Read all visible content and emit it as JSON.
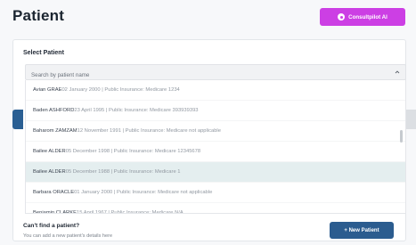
{
  "header": {
    "title": "Patient",
    "ai_button_label": "Consultpilot AI"
  },
  "select_patient": {
    "label": "Select Patient",
    "search_placeholder": "Search by patient name",
    "options": [
      {
        "name": "Avian GRAE",
        "details": "02 January 2000 | Public Insurance: Medicare 1234",
        "highlighted": false
      },
      {
        "name": "Baden ASHFORD",
        "details": "23 April 1995 | Public Insurance: Medicare 393939393",
        "highlighted": false
      },
      {
        "name": "Baharom ZAMZAM",
        "details": "12 November 1991 | Public Insurance: Medicare not applicable",
        "highlighted": false
      },
      {
        "name": "Bailee ALDER",
        "details": "05 December 1998 | Public Insurance: Medicare 12345678",
        "highlighted": false
      },
      {
        "name": "Bailee ALDER",
        "details": "05 December 1988 | Public Insurance: Medicare 1",
        "highlighted": true
      },
      {
        "name": "Barbara ORACLE",
        "details": "01 January 2000 | Public Insurance: Medicare not applicable",
        "highlighted": false
      },
      {
        "name": "Benjamin CLARKE",
        "details": "15 April 1967 | Public Insurance: Medicare N/A",
        "highlighted": false
      }
    ]
  },
  "footer": {
    "cant_find_title": "Can't find a patient?",
    "cant_find_subtitle": "You can add a new patient's details here",
    "new_patient_label": "+ New Patient"
  },
  "colors": {
    "ai_button": "#cc3fe4",
    "primary": "#2b5c8f",
    "highlight_row": "#e4eeef"
  }
}
